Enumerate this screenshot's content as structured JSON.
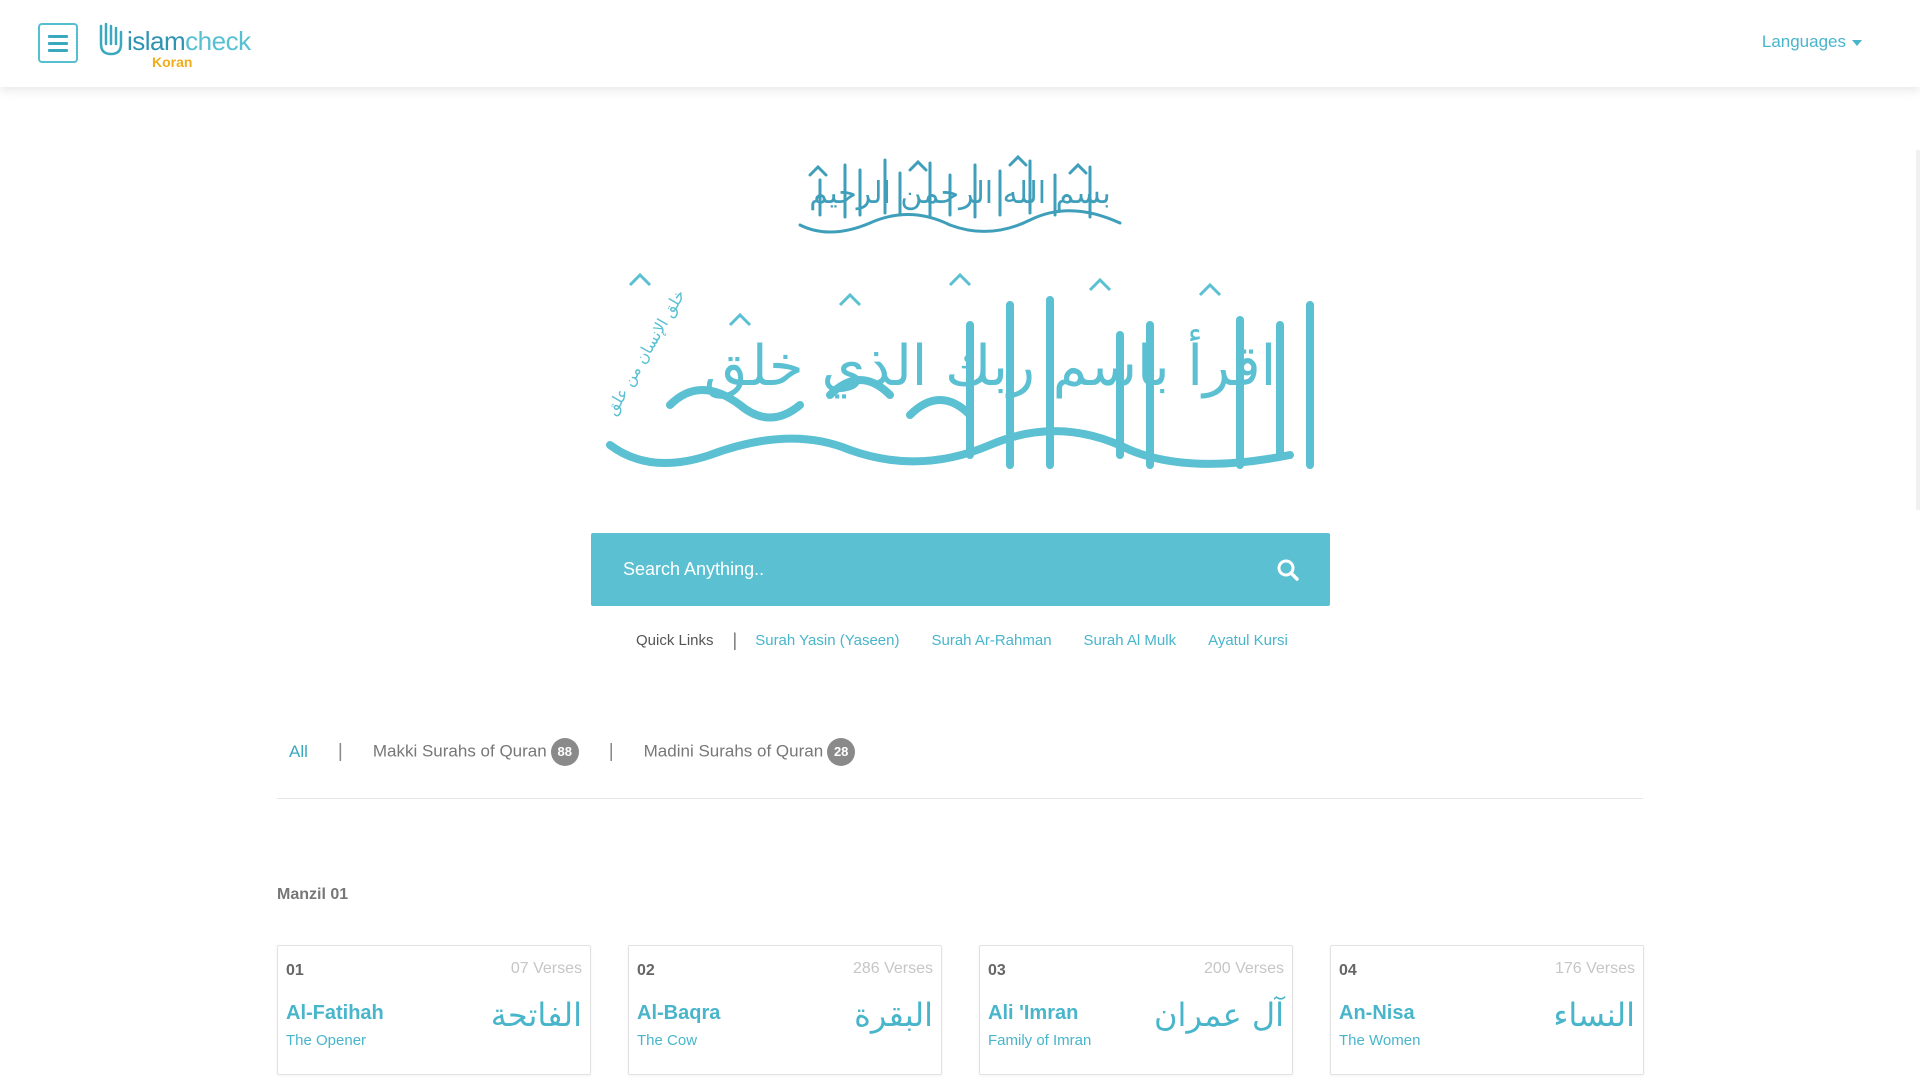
{
  "header": {
    "logo": {
      "brand_islam": "islam",
      "brand_check": "check",
      "sub": "Koran"
    },
    "languages_label": "Languages"
  },
  "hero": {
    "bismillah_arabic": "بسم الله الرحمن الرحيم",
    "verse_arabic": "اقرأ باسم ربك الذي خلق",
    "verse_small_arabic": "خلق الإنسان من علق"
  },
  "search": {
    "placeholder": "Search Anything.."
  },
  "quick_links": {
    "label": "Quick Links",
    "links": [
      "Surah Yasin (Yaseen)",
      "Surah Ar-Rahman",
      "Surah Al Mulk",
      "Ayatul Kursi"
    ]
  },
  "filters": {
    "all": "All",
    "makki": {
      "label": "Makki Surahs of Quran",
      "count": "88"
    },
    "madini": {
      "label": "Madini Surahs of Quran",
      "count": "28"
    }
  },
  "manzil": {
    "title": "Manzil 01"
  },
  "surahs": [
    {
      "num": "01",
      "verses": "07 Verses",
      "name": "Al-Fatihah",
      "meaning": "The Opener",
      "arabic": "الفاتحة"
    },
    {
      "num": "02",
      "verses": "286 Verses",
      "name": "Al-Baqra",
      "meaning": "The Cow",
      "arabic": "البقرة"
    },
    {
      "num": "03",
      "verses": "200 Verses",
      "name": "Ali 'Imran",
      "meaning": "Family of Imran",
      "arabic": "آل عمران"
    },
    {
      "num": "04",
      "verses": "176 Verses",
      "name": "An-Nisa",
      "meaning": "The Women",
      "arabic": "النساء"
    }
  ],
  "colors": {
    "accent": "#5ac0d2",
    "link": "#48b5cb",
    "brand_dark": "#2f93b3",
    "brand_yellow": "#f0ad1a",
    "badge": "#8a8a8a"
  },
  "icons": [
    "hamburger-menu-icon",
    "hand-logo-icon",
    "caret-down-icon",
    "search-icon"
  ]
}
